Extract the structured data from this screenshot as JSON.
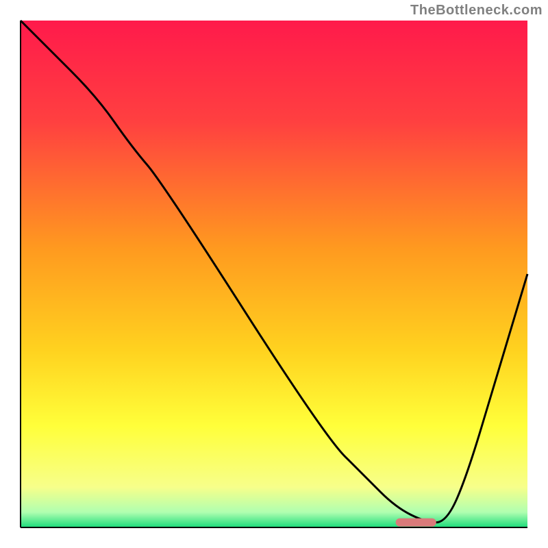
{
  "watermark": "TheBottleneck.com",
  "chart_data": {
    "type": "line",
    "title": "",
    "xlabel": "",
    "ylabel": "",
    "xlim": [
      0,
      100
    ],
    "ylim": [
      0,
      100
    ],
    "gradient_stops": [
      {
        "offset": 0.0,
        "color": "#ff1a4b"
      },
      {
        "offset": 0.2,
        "color": "#ff4040"
      },
      {
        "offset": 0.45,
        "color": "#ff9a1f"
      },
      {
        "offset": 0.65,
        "color": "#ffd21f"
      },
      {
        "offset": 0.8,
        "color": "#ffff3a"
      },
      {
        "offset": 0.92,
        "color": "#f7ff8a"
      },
      {
        "offset": 0.97,
        "color": "#b0ffb0"
      },
      {
        "offset": 1.0,
        "color": "#1adb7a"
      }
    ],
    "series": [
      {
        "name": "bottleneck-curve",
        "x": [
          0,
          5,
          15,
          22,
          28,
          60,
          68,
          74,
          80,
          84,
          88,
          94,
          100
        ],
        "values": [
          100,
          95,
          85,
          75,
          68,
          18,
          10,
          4,
          1,
          1,
          10,
          30,
          50
        ]
      }
    ],
    "marker": {
      "name": "optimal-zone",
      "x_start": 74,
      "x_end": 82,
      "y": 1,
      "color": "#d97a7a"
    },
    "axes_color": "#000000",
    "line_color": "#000000"
  }
}
